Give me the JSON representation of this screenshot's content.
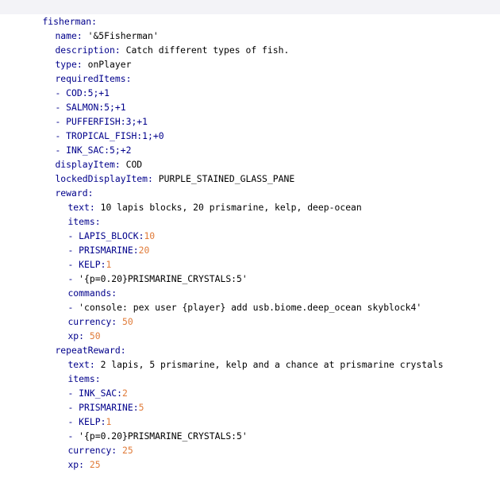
{
  "lines": [
    [
      {
        "t": "fisherman:",
        "c": "k"
      }
    ],
    [
      {
        "t": "name: ",
        "c": "k"
      },
      {
        "t": "'&5Fisherman'",
        "c": "t"
      }
    ],
    [
      {
        "t": "description: ",
        "c": "k"
      },
      {
        "t": "Catch different types of fish.",
        "c": "t"
      }
    ],
    [
      {
        "t": "type: ",
        "c": "k"
      },
      {
        "t": "onPlayer",
        "c": "t"
      }
    ],
    [
      {
        "t": "requiredItems:",
        "c": "k"
      }
    ],
    [
      {
        "t": "- COD:5;+1",
        "c": "k"
      }
    ],
    [
      {
        "t": "- SALMON:5;+1",
        "c": "k"
      }
    ],
    [
      {
        "t": "- PUFFERFISH:3;+1",
        "c": "k"
      }
    ],
    [
      {
        "t": "- TROPICAL_FISH:1;+0",
        "c": "k"
      }
    ],
    [
      {
        "t": "- INK_SAC:5;+2",
        "c": "k"
      }
    ],
    [
      {
        "t": "displayItem: ",
        "c": "k"
      },
      {
        "t": "COD",
        "c": "t"
      }
    ],
    [
      {
        "t": "lockedDisplayItem: ",
        "c": "k"
      },
      {
        "t": "PURPLE_STAINED_GLASS_PANE",
        "c": "t"
      }
    ],
    [
      {
        "t": "reward:",
        "c": "k"
      }
    ],
    [
      {
        "t": "text: ",
        "c": "k"
      },
      {
        "t": "10 lapis blocks, 20 prismarine, kelp, deep-ocean",
        "c": "t"
      }
    ],
    [
      {
        "t": "items:",
        "c": "k"
      }
    ],
    [
      {
        "t": "- LAPIS_BLOCK:",
        "c": "k"
      },
      {
        "t": "10",
        "c": "n"
      }
    ],
    [
      {
        "t": "- PRISMARINE:",
        "c": "k"
      },
      {
        "t": "20",
        "c": "n"
      }
    ],
    [
      {
        "t": "- KELP:",
        "c": "k"
      },
      {
        "t": "1",
        "c": "n"
      }
    ],
    [
      {
        "t": "- ",
        "c": "k"
      },
      {
        "t": "'{p=0.20}PRISMARINE_CRYSTALS:5'",
        "c": "t"
      }
    ],
    [
      {
        "t": "commands:",
        "c": "k"
      }
    ],
    [
      {
        "t": "- ",
        "c": "k"
      },
      {
        "t": "'console: pex user {player} add usb.biome.deep_ocean skyblock4'",
        "c": "t"
      }
    ],
    [
      {
        "t": "currency: ",
        "c": "k"
      },
      {
        "t": "50",
        "c": "n"
      }
    ],
    [
      {
        "t": "xp: ",
        "c": "k"
      },
      {
        "t": "50",
        "c": "n"
      }
    ],
    [
      {
        "t": "repeatReward:",
        "c": "k"
      }
    ],
    [
      {
        "t": "text: ",
        "c": "k"
      },
      {
        "t": "2 lapis, 5 prismarine, kelp and a chance at prismarine crystals",
        "c": "t"
      }
    ],
    [
      {
        "t": "items:",
        "c": "k"
      }
    ],
    [
      {
        "t": "- INK_SAC:",
        "c": "k"
      },
      {
        "t": "2",
        "c": "n"
      }
    ],
    [
      {
        "t": "- PRISMARINE:",
        "c": "k"
      },
      {
        "t": "5",
        "c": "n"
      }
    ],
    [
      {
        "t": "- KELP:",
        "c": "k"
      },
      {
        "t": "1",
        "c": "n"
      }
    ],
    [
      {
        "t": "- ",
        "c": "k"
      },
      {
        "t": "'{p=0.20}PRISMARINE_CRYSTALS:5'",
        "c": "t"
      }
    ],
    [
      {
        "t": "currency: ",
        "c": "k"
      },
      {
        "t": "25",
        "c": "n"
      }
    ],
    [
      {
        "t": "xp: ",
        "c": "k"
      },
      {
        "t": "25",
        "c": "n"
      }
    ]
  ],
  "colors": {
    "key": "#00008b",
    "number": "#e07b39",
    "text": "#000000",
    "active_line": "#f3f3f7",
    "background": "#ffffff"
  }
}
